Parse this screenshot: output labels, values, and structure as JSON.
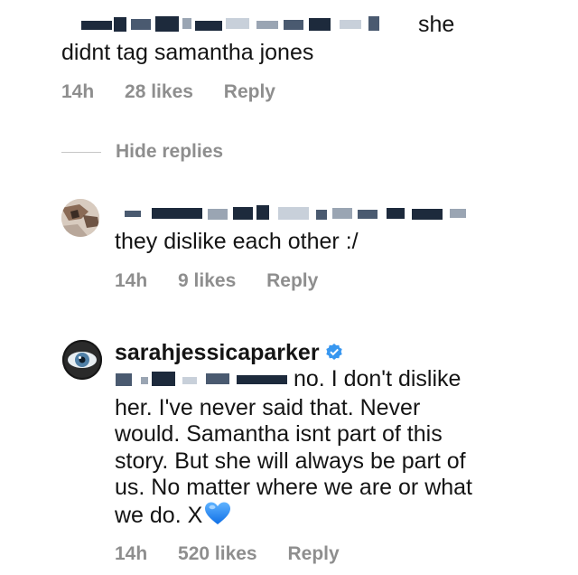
{
  "comment1": {
    "text_line1_tail": "she",
    "text_line2": "didnt tag samantha jones",
    "time": "14h",
    "likes": "28 likes",
    "reply": "Reply"
  },
  "hide_replies": "Hide replies",
  "comment2": {
    "text": "they dislike each other :/",
    "time": "14h",
    "likes": "9 likes",
    "reply": "Reply"
  },
  "comment3": {
    "username": "sarahjessicaparker",
    "verified_icon": "verified-badge-icon",
    "line1_tail": "no. I don't dislike",
    "lines": [
      "her.  I've never said that. Never",
      "would. Samantha isnt part of this",
      "story. But she will always be part of",
      "us. No matter where we are or what"
    ],
    "last_line": "we do. X",
    "heart_icon": "blue-heart-icon",
    "time": "14h",
    "likes": "520 likes",
    "reply": "Reply"
  },
  "colors": {
    "text": "#141414",
    "meta": "#8e8e8e",
    "verified": "#3897f0",
    "heart": "#1e7ff0"
  }
}
